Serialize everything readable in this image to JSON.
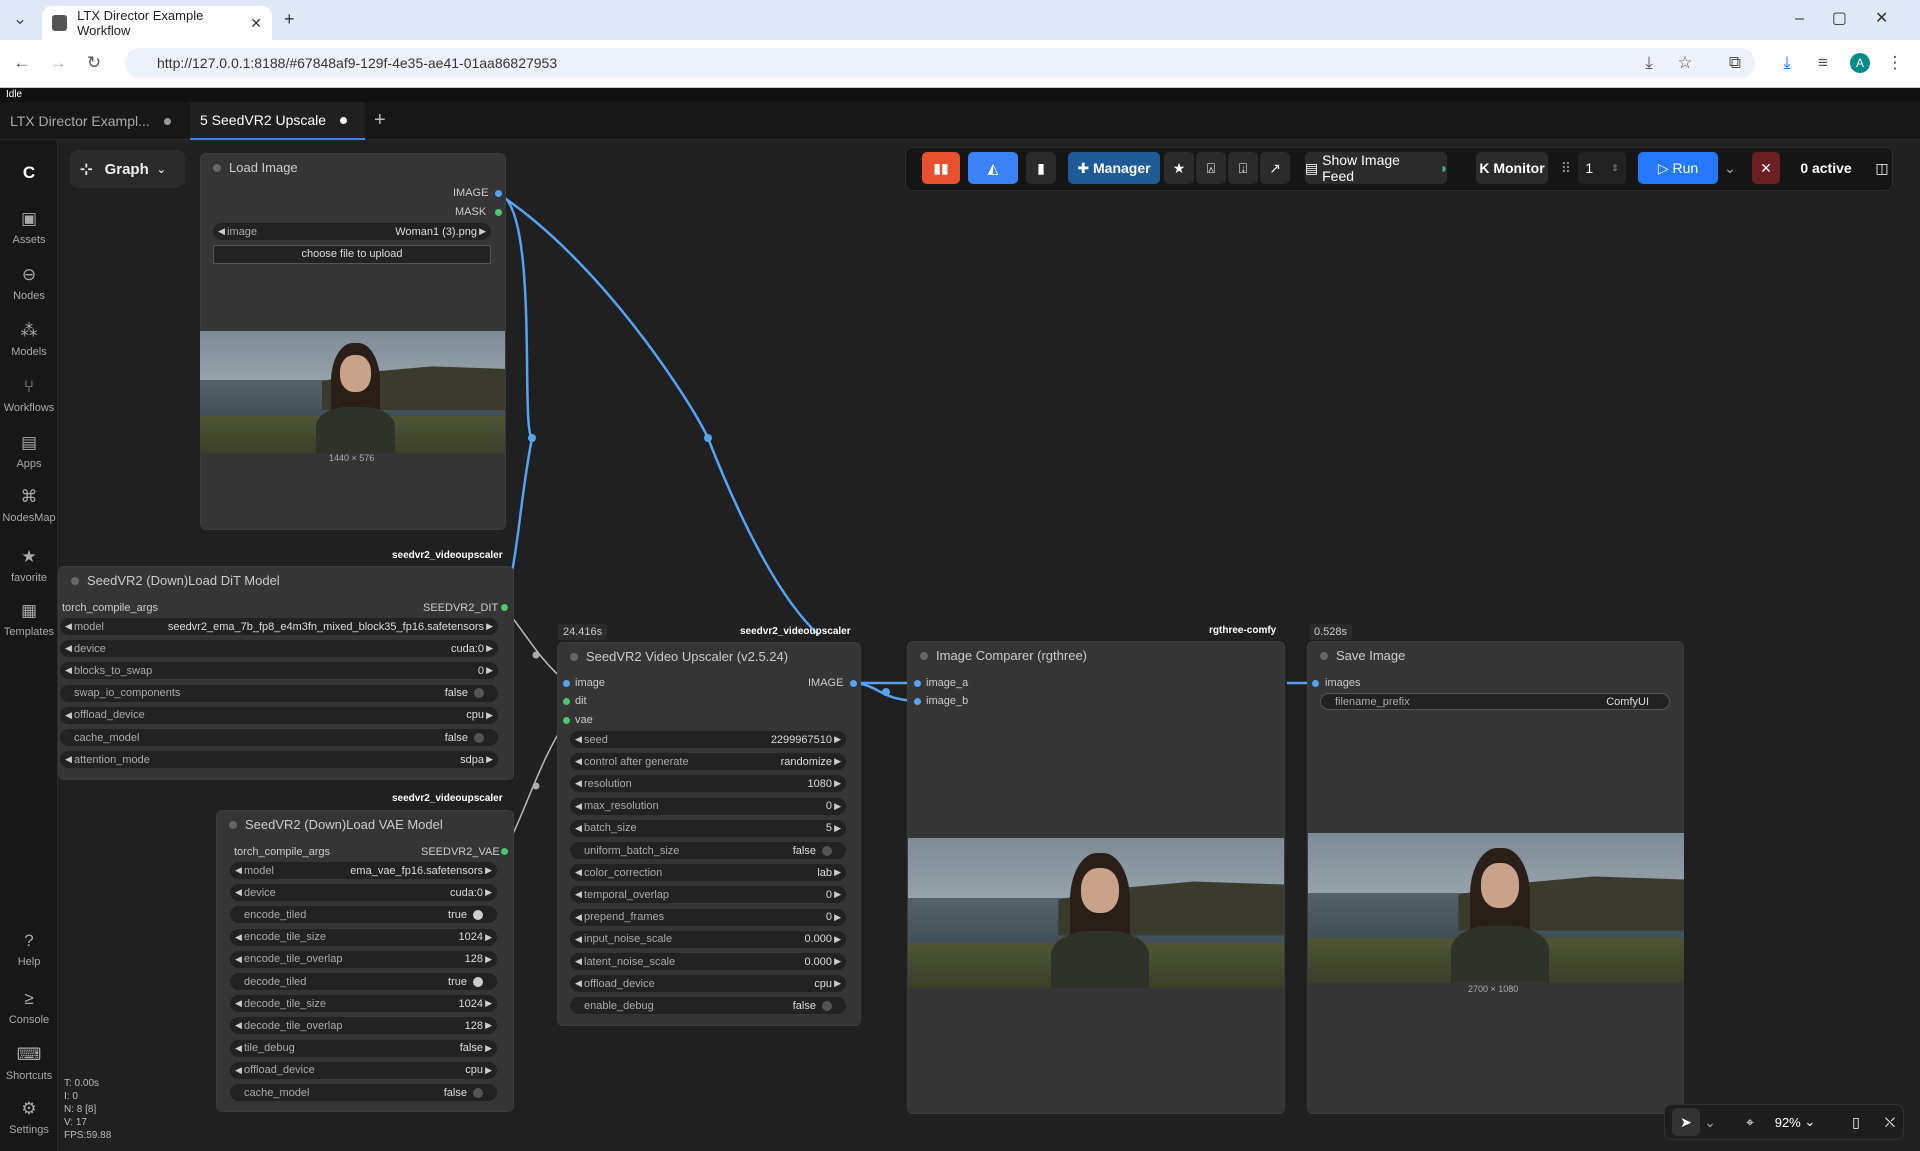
{
  "browser": {
    "tab_title": "LTX Director Example Workflow",
    "url": "http://127.0.0.1:8188/#67848af9-129f-4e35-ae41-01aa86827953",
    "profile_initial": "A"
  },
  "status": "Idle",
  "workflow_tabs": [
    {
      "label": "LTX Director Exampl..."
    },
    {
      "label": "5 SeedVR2 Upscale"
    }
  ],
  "sidebar": [
    {
      "label": "Assets"
    },
    {
      "label": "Nodes"
    },
    {
      "label": "Models"
    },
    {
      "label": "Workflows"
    },
    {
      "label": "Apps"
    },
    {
      "label": "NodesMap"
    },
    {
      "label": "favorite"
    },
    {
      "label": "Templates"
    },
    {
      "label": "Help"
    },
    {
      "label": "Console"
    },
    {
      "label": "Shortcuts"
    },
    {
      "label": "Settings"
    }
  ],
  "graph_label": "Graph",
  "toolbar": {
    "manager": "Manager",
    "show_image_feed": "Show Image Feed",
    "monitor": "Monitor",
    "queue_count": "1",
    "run": "Run",
    "active": "0 active"
  },
  "nodes": {
    "load_image": {
      "title": "Load Image",
      "out_image": "IMAGE",
      "out_mask": "MASK",
      "image_label": "image",
      "image_value": "Woman1 (3).png",
      "upload": "choose file to upload",
      "dims": "1440 × 576"
    },
    "dit": {
      "tag": "seedvr2_videoupscaler",
      "title": "SeedVR2 (Down)Load DiT Model",
      "in": "torch_compile_args",
      "out": "SEEDVR2_DIT",
      "widgets": [
        {
          "k": "model",
          "v": "seedvr2_ema_7b_fp8_e4m3fn_mixed_block35_fp16.safetensors"
        },
        {
          "k": "device",
          "v": "cuda:0"
        },
        {
          "k": "blocks_to_swap",
          "v": "0"
        },
        {
          "k": "swap_io_components",
          "v": "false"
        },
        {
          "k": "offload_device",
          "v": "cpu"
        },
        {
          "k": "cache_model",
          "v": "false"
        },
        {
          "k": "attention_mode",
          "v": "sdpa"
        }
      ]
    },
    "vae": {
      "tag": "seedvr2_videoupscaler",
      "title": "SeedVR2 (Down)Load VAE Model",
      "in": "torch_compile_args",
      "out": "SEEDVR2_VAE",
      "widgets": [
        {
          "k": "model",
          "v": "ema_vae_fp16.safetensors"
        },
        {
          "k": "device",
          "v": "cuda:0"
        },
        {
          "k": "encode_tiled",
          "v": "true"
        },
        {
          "k": "encode_tile_size",
          "v": "1024"
        },
        {
          "k": "encode_tile_overlap",
          "v": "128"
        },
        {
          "k": "decode_tiled",
          "v": "true"
        },
        {
          "k": "decode_tile_size",
          "v": "1024"
        },
        {
          "k": "decode_tile_overlap",
          "v": "128"
        },
        {
          "k": "tile_debug",
          "v": "false"
        },
        {
          "k": "offload_device",
          "v": "cpu"
        },
        {
          "k": "cache_model",
          "v": "false"
        }
      ]
    },
    "upscaler": {
      "tag": "seedvr2_videoupscaler",
      "timer": "24.416s",
      "title": "SeedVR2 Video Upscaler (v2.5.24)",
      "in_image": "image",
      "in_dit": "dit",
      "in_vae": "vae",
      "out": "IMAGE",
      "widgets": [
        {
          "k": "seed",
          "v": "2299967510"
        },
        {
          "k": "control after generate",
          "v": "randomize"
        },
        {
          "k": "resolution",
          "v": "1080"
        },
        {
          "k": "max_resolution",
          "v": "0"
        },
        {
          "k": "batch_size",
          "v": "5"
        },
        {
          "k": "uniform_batch_size",
          "v": "false"
        },
        {
          "k": "color_correction",
          "v": "lab"
        },
        {
          "k": "temporal_overlap",
          "v": "0"
        },
        {
          "k": "prepend_frames",
          "v": "0"
        },
        {
          "k": "input_noise_scale",
          "v": "0.000"
        },
        {
          "k": "latent_noise_scale",
          "v": "0.000"
        },
        {
          "k": "offload_device",
          "v": "cpu"
        },
        {
          "k": "enable_debug",
          "v": "false"
        }
      ]
    },
    "comparer": {
      "tag": "rgthree-comfy",
      "title": "Image Comparer (rgthree)",
      "in_a": "image_a",
      "in_b": "image_b"
    },
    "save": {
      "timer": "0.528s",
      "title": "Save Image",
      "in": "images",
      "prefix_label": "filename_prefix",
      "prefix_value": "ComfyUI",
      "dims": "2700 × 1080"
    }
  },
  "stats": [
    "T: 0.00s",
    "I: 0",
    "N: 8 [8]",
    "V: 17",
    "FPS:59.88"
  ],
  "zoom": "92%"
}
